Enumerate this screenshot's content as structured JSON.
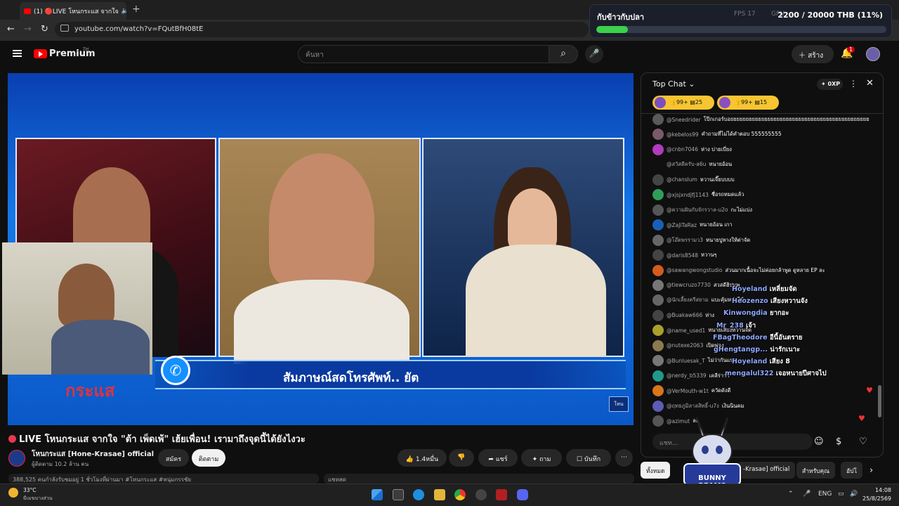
{
  "browser": {
    "tab_title": "(1) 🔴LIVE โหนกระแส จากใจ",
    "url": "youtube.com/watch?v=FQutBfH08tE"
  },
  "donation": {
    "title": "กับข้าวกับปลา",
    "amount": "2200 / 20000 THB (11%)",
    "progress": 0.11,
    "fps_label": "FPS",
    "fps_value": "17",
    "ping_label": "GPU"
  },
  "youtube": {
    "logo": "Premium",
    "logo_suffix": "TH",
    "search_placeholder": "ค้นหา",
    "create_label": "สร้าง",
    "notif_count": "1"
  },
  "video": {
    "lower_third": "สัมภาษณ์สดโทรศัพท์.. ยัต",
    "show_logo": "กระแส",
    "title": "LIVE โหนกระแส จากใจ \"ต้า เพ็ดเพ้\" เฮ้ยเพื่อน! เรามาถึงจุดนี้ได้ยังไงวะ",
    "channel_name": "โหนกระแส [Hone-Krasae] official",
    "subscribers": "ผู้ติดตาม 10.2 ล้าน คน",
    "join_label": "สมัคร",
    "subscribe_label": "ติดตาม",
    "like_count": "1.4หมื่น",
    "share_label": "แชร์",
    "ask_label": "ถาม",
    "save_label": "บันทึก",
    "desc_text": "388,525 คนกำลังรับชมอยู่ 1 ชั่วโมงที่ผ่านมา  #โหนกระแส #หนุ่มกรรชัย",
    "desc2_text": "แชทสด"
  },
  "chat": {
    "header": "Top Chat",
    "xp_label": "0XP",
    "top_pills": [
      {
        "likes": "99+",
        "comments": "25"
      },
      {
        "likes": "99+",
        "comments": "15"
      }
    ],
    "messages": [
      {
        "name": "@Sneedrider",
        "text": "โป๊กเกอร์บอยยยยยยยยยยยยยยยยยยยยยยยยยยยยยยยยยยยยยยยยยยยยย",
        "color": "#5a5a5a"
      },
      {
        "name": "@kebelos99",
        "text": "คำถามที่ไม่ได้คำตอบ 555555555",
        "color": "#7a5a6a"
      },
      {
        "name": "@cnbn7046",
        "text": "ห่าง บ่ายเบี่ยง",
        "color": "#b13bbf"
      },
      {
        "name": "@สวัสดีครับ-a6u",
        "text": "หนายอ้อน",
        "color": "#0f0f0f"
      },
      {
        "name": "@chanslum",
        "text": "หวานเจี๊ยบบบบ",
        "color": "#444"
      },
      {
        "name": "@xjsjxndjfj1143",
        "text": "ชื่อรถหมดแล้ว",
        "color": "#2e9e58"
      },
      {
        "name": "@ความฝันกับจักรวาล-u2o",
        "text": "กะไม่แบ่ง",
        "color": "#555"
      },
      {
        "name": "@ZaJiTaRaz",
        "text": "หนายอ้อน เกา",
        "color": "#1a5fb8"
      },
      {
        "name": "@โอ๊ตพรรามว3",
        "text": "หนายปูหางให้ต่าจัด",
        "color": "#666"
      },
      {
        "name": "@daris8548",
        "text": "หวานๆ",
        "color": "#444"
      },
      {
        "name": "@sawangwongstudio",
        "text": "ส่วนมากเนื้อจะไม่ค่อยกล้าพูด ดูหลาย EP ละ",
        "color": "#d45b1f"
      },
      {
        "name": "@tiewcruzo7730",
        "text": "สวสดีฮิปนพ",
        "color": "#777"
      },
      {
        "name": "@นักเลี้ยงครีสยาม",
        "text": "แบะคุ้มหน่ะไพ้",
        "color": "#666"
      },
      {
        "name": "@Buakaw666",
        "text": "ห่าง",
        "color": "#444"
      },
      {
        "name": "@name_used1",
        "text": "หนายเสียงหวานจัด",
        "color": "#a8a02a"
      },
      {
        "name": "@nutexe2063",
        "text": "เปิดพ่อง",
        "color": "#8c7a4e"
      },
      {
        "name": "@Bunluesak_T",
        "text": "ไม่ว่ากันแบบ",
        "color": "#777"
      },
      {
        "name": "@nerdy_b5339",
        "text": "เคลีร่าาา",
        "color": "#1f9a8a"
      },
      {
        "name": "@VerMouth-w1t",
        "text": "ควัดดังดี",
        "color": "#d9751a"
      },
      {
        "name": "@ฤทธภูมิลาลสิทธิ์-u7ง",
        "text": "เงินนินคม",
        "color": "#5e5ab8"
      },
      {
        "name": "@azimut",
        "text": "ละ",
        "color": "#555"
      }
    ],
    "overlay_names": [
      {
        "name": "Hoyeland",
        "text": "เหลี่ยมจัด"
      },
      {
        "name": "Heozenzo",
        "text": "เสียงหวานจัง"
      },
      {
        "name": "Kinwongdia",
        "text": "ยากอะ"
      },
      {
        "name": "Mr_238",
        "text": "เจ้า"
      },
      {
        "name": "FBagTheodore",
        "text": "อีนี้อันตราย"
      },
      {
        "name": "gHengtangp...",
        "text": "น่ารักเนาะ"
      },
      {
        "name": "Hoyeland",
        "text": "เสียง 8"
      },
      {
        "name": "mengalul322",
        "text": "เจอหนายปีศาจไป"
      }
    ],
    "input_placeholder": "แชท..."
  },
  "chips": [
    {
      "label": "ทั้งหมด",
      "active": true
    },
    {
      "label": "-Krasae] official",
      "active": false
    },
    {
      "label": "สำหรับคุณ",
      "active": false
    },
    {
      "label": "อัปโ",
      "active": false
    }
  ],
  "taskbar": {
    "temp": "33°C",
    "weather_desc": "มีเมฆบางส่วน",
    "lang": "ENG",
    "time": "14:08",
    "date": "25/8/2569"
  },
  "bunny_logo": "BUNNY BEAMS"
}
